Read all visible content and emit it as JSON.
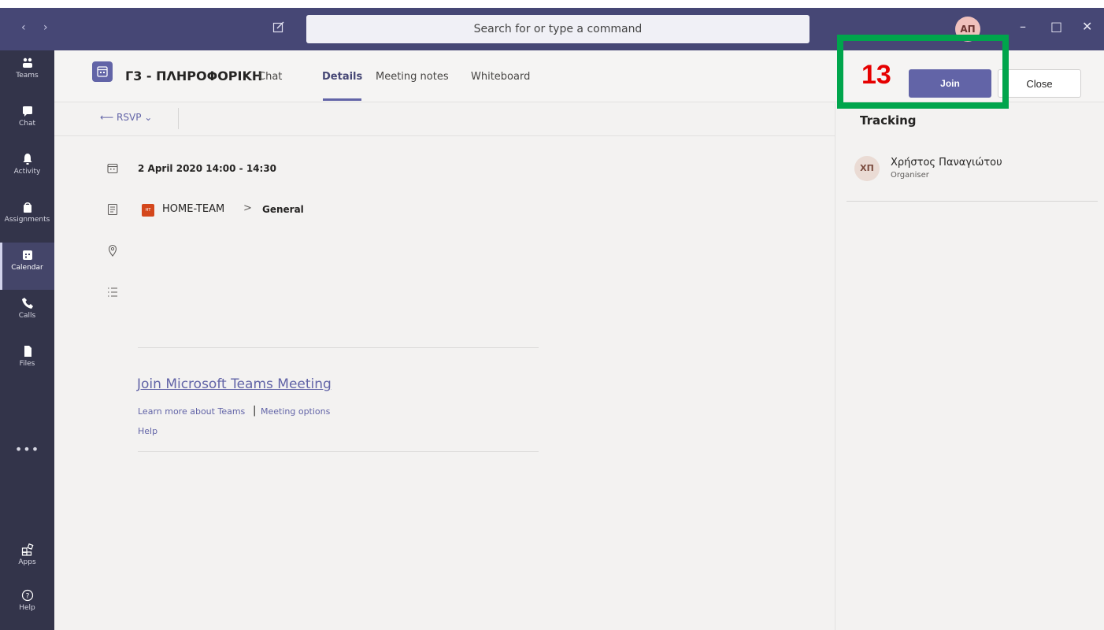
{
  "titlebar": {
    "back": "‹",
    "forward": "›",
    "search_placeholder": "Search for or type a command",
    "avatar_initials": "ΑΠ",
    "min": "–",
    "max": "□",
    "close": "✕",
    "color": "#464775"
  },
  "rail": {
    "items": [
      {
        "label": "Teams",
        "icon": "teams-icon"
      },
      {
        "label": "Chat",
        "icon": "chat-icon"
      },
      {
        "label": "Activity",
        "icon": "bell-icon"
      },
      {
        "label": "Assignments",
        "icon": "bag-icon"
      },
      {
        "label": "Calendar",
        "icon": "calendar-icon",
        "active": true
      },
      {
        "label": "Calls",
        "icon": "phone-icon"
      },
      {
        "label": "Files",
        "icon": "file-icon"
      },
      {
        "label": "Apps",
        "icon": "apps-icon"
      },
      {
        "label": "Help",
        "icon": "help-icon"
      }
    ],
    "more": "•••"
  },
  "header": {
    "title": "Γ3 - ΠΛΗΡΟΦΟΡΙΚΗ",
    "tabs": [
      "Chat",
      "Details",
      "Meeting notes",
      "Whiteboard"
    ],
    "active_tab": "Details",
    "join_label": "Join",
    "close_label": "Close",
    "accent": "#6264a7"
  },
  "toolbar": {
    "rsvp_label": "RSVP"
  },
  "details": {
    "date": "2 April 2020 14:00 - 14:30",
    "team_badge": "HT",
    "team_name": "HOME-TEAM",
    "separator": ">",
    "channel": "General",
    "join_link": "Join Microsoft Teams Meeting",
    "learn_more": "Learn more about Teams",
    "pipe": "|",
    "meeting_options": "Meeting options",
    "help": "Help"
  },
  "tracking": {
    "title": "Tracking",
    "person": {
      "initials": "ΧΠ",
      "name": "Χρήστος Παναγιώτου",
      "role": "Organiser"
    }
  },
  "annotation": {
    "step": "13",
    "box_color": "#00a54c",
    "number_color": "#e60000"
  }
}
